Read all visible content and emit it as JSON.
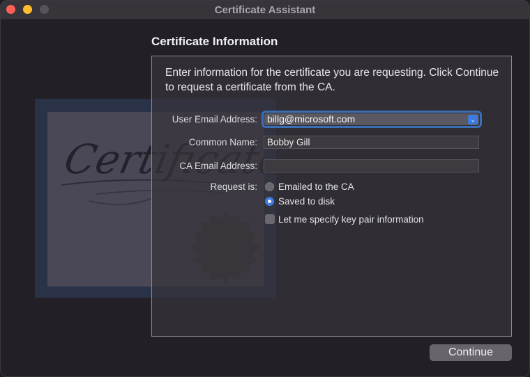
{
  "window": {
    "title": "Certificate Assistant"
  },
  "section": {
    "title": "Certificate Information"
  },
  "intro": "Enter information for the certificate you are requesting. Click Continue to request a certificate from the CA.",
  "form": {
    "user_email_label": "User Email Address:",
    "user_email_value": "billg@microsoft.com",
    "common_name_label": "Common Name:",
    "common_name_value": "Bobby Gill",
    "ca_email_label": "CA Email Address:",
    "ca_email_value": "",
    "request_label": "Request is:",
    "request_options": [
      {
        "label": "Emailed to the CA",
        "selected": false
      },
      {
        "label": "Saved to disk",
        "selected": true
      }
    ],
    "keypair_label": "Let me specify key pair information",
    "keypair_checked": false
  },
  "certificate_graphic": {
    "text": "Certificate"
  },
  "icons": {
    "select_arrow": "chevron-updown-icon"
  },
  "buttons": {
    "continue": "Continue"
  },
  "colors": {
    "accent": "#3e7be0",
    "focus_ring": "#3a6fb5"
  }
}
